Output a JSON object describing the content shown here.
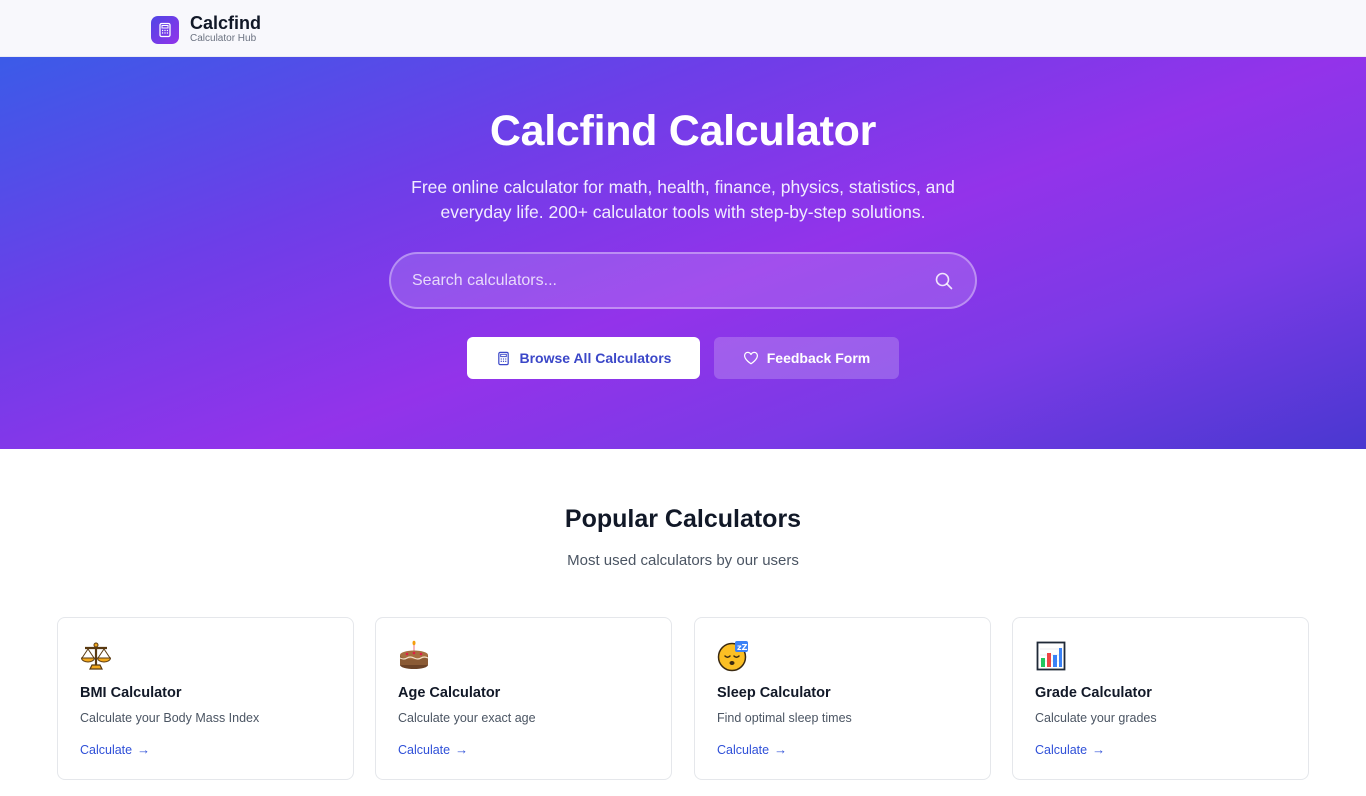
{
  "header": {
    "brand_name": "Calcfind",
    "brand_tagline": "Calculator Hub",
    "logo_icon": "calculator-icon"
  },
  "hero": {
    "title": "Calcfind Calculator",
    "subtitle": "Free online calculator for math, health, finance, physics, statistics, and everyday life. 200+ calculator tools with step-by-step solutions.",
    "search_placeholder": "Search calculators...",
    "search_value": "",
    "browse_button": "Browse All Calculators",
    "feedback_button": "Feedback Form"
  },
  "popular": {
    "title": "Popular Calculators",
    "subtitle": "Most used calculators by our users",
    "cards": [
      {
        "icon": "balance-scale-icon",
        "title": "BMI Calculator",
        "description": "Calculate your Body Mass Index",
        "link": "Calculate"
      },
      {
        "icon": "birthday-cake-icon",
        "title": "Age Calculator",
        "description": "Calculate your exact age",
        "link": "Calculate"
      },
      {
        "icon": "sleeping-face-icon",
        "title": "Sleep Calculator",
        "description": "Find optimal sleep times",
        "link": "Calculate"
      },
      {
        "icon": "bar-chart-icon",
        "title": "Grade Calculator",
        "description": "Calculate your grades",
        "link": "Calculate"
      }
    ]
  },
  "colors": {
    "hero_start": "#3b5be8",
    "hero_mid": "#9333ea",
    "hero_end": "#4938d0",
    "link": "#2f50d8",
    "primary_button_text": "#3b47c8"
  }
}
